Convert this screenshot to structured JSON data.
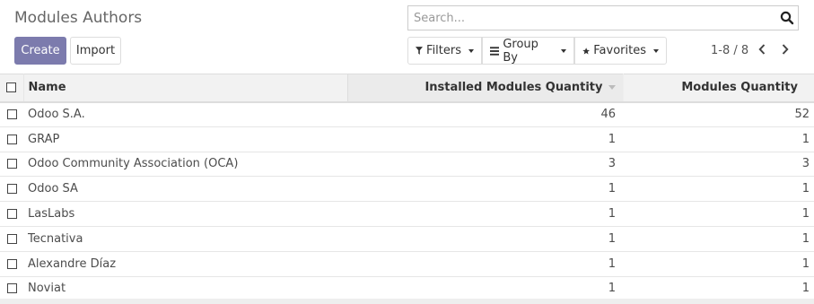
{
  "page": {
    "title": "Modules Authors"
  },
  "search": {
    "placeholder": "Search..."
  },
  "actions": {
    "create_label": "Create",
    "import_label": "Import"
  },
  "filters": {
    "filters_label": "Filters",
    "groupby_label": "Group By",
    "favorites_label": "Favorites"
  },
  "pager": {
    "range": "1-8 / 8"
  },
  "table": {
    "headers": {
      "name": "Name",
      "installed": "Installed Modules Quantity",
      "quantity": "Modules Quantity"
    },
    "rows": [
      {
        "name": "Odoo S.A.",
        "installed": "46",
        "quantity": "52"
      },
      {
        "name": "GRAP",
        "installed": "1",
        "quantity": "1"
      },
      {
        "name": "Odoo Community Association (OCA)",
        "installed": "3",
        "quantity": "3"
      },
      {
        "name": "Odoo SA",
        "installed": "1",
        "quantity": "1"
      },
      {
        "name": "LasLabs",
        "installed": "1",
        "quantity": "1"
      },
      {
        "name": "Tecnativa",
        "installed": "1",
        "quantity": "1"
      },
      {
        "name": "Alexandre Díaz",
        "installed": "1",
        "quantity": "1"
      },
      {
        "name": "Noviat",
        "installed": "1",
        "quantity": "1"
      }
    ]
  },
  "colors": {
    "primary": "#7c7bad"
  }
}
